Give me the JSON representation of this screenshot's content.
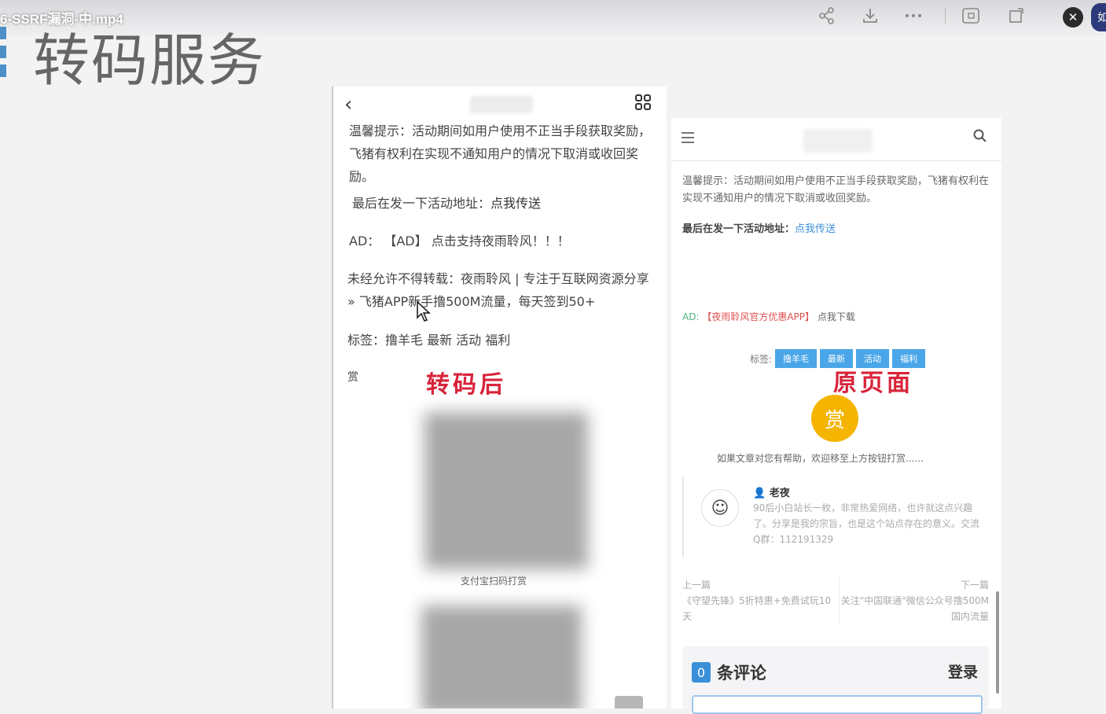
{
  "window": {
    "file_title": "6-SSRF漏洞-中.mp4",
    "toolbar_icons": [
      "share-icon",
      "download-icon",
      "more-icon",
      "screenshot-icon",
      "pip-icon",
      "close-icon"
    ],
    "avatar_text": "如"
  },
  "slide": {
    "title": "转码服务"
  },
  "left_phone": {
    "annotation": "转码后",
    "paragraph1": "温馨提示：活动期间如用户使用不正当手段获取奖励，飞猪有权利在实现不通知用户的情况下取消或收回奖励。",
    "activity_prefix": "最后在发一下活动地址：",
    "activity_link": "点我传送",
    "ad_line": "AD： 【AD】 点击支持夜雨聆风！！！",
    "copyright": "未经允许不得转载：夜雨聆风 | 专注于互联网资源分享 » 飞猪APP新手撸500M流量，每天签到50+",
    "tags": "标签：撸羊毛 最新 活动 福利",
    "reward_label": "赏",
    "qr_caption": "支付宝扫码打赏"
  },
  "right_page": {
    "annotation": "原页面",
    "notice": "温馨提示：活动期间如用户使用不正当手段获取奖励，飞猪有权利在实现不通知用户的情况下取消或收回奖励。",
    "activity_prefix": "最后在发一下活动地址：",
    "activity_link": "点我传送",
    "ad_label": "AD:",
    "ad_text": "【夜雨聆风官方优惠APP】",
    "ad_download": "点我下载",
    "tags_label": "标签:",
    "tags": [
      "撸羊毛",
      "最新",
      "活动",
      "福利"
    ],
    "reward_button": "赏",
    "reward_message": "如果文章对您有帮助，欢迎移至上方按钮打赏......",
    "author_name": "老夜",
    "author_bio": "90后小白站长一枚，非常热爱网络，也许就这点兴趣了。分享是我的宗旨，也是这个站点存在的意义。交流Q群：112191329",
    "prev_label": "上一篇",
    "prev_title": "《守望先锋》5折特惠+免费试玩10天",
    "next_label": "下一篇",
    "next_title": "关注\"中国联通\"微信公众号撸500M国内流量",
    "comment_count": "0",
    "comment_label": "条评论",
    "login_label": "登录"
  }
}
